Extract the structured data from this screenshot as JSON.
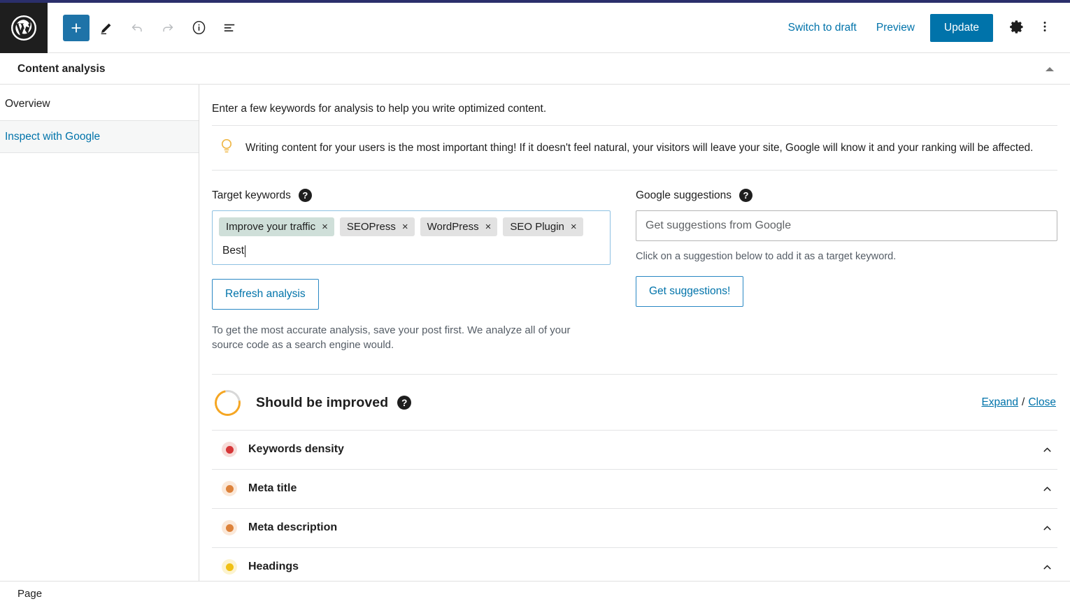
{
  "theme": {
    "accent_blue": "#0073aa",
    "strip_purple": "#2b2f6b",
    "logo_bg": "#1e1e1e",
    "tag_gray": "#e2e2e2",
    "tag_highlight_green": "#cfdfd9",
    "ring_orange": "#f5a623"
  },
  "topbar": {
    "logo_icon": "wordpress-logo-icon",
    "tools": [
      {
        "name": "add-block-button",
        "icon": "plus-icon",
        "label": "+"
      },
      {
        "name": "edit-tool-button",
        "icon": "pencil-icon",
        "label": ""
      },
      {
        "name": "undo-button",
        "icon": "undo-arrow-icon",
        "label": ""
      },
      {
        "name": "redo-button",
        "icon": "redo-arrow-icon",
        "label": ""
      },
      {
        "name": "details-button",
        "icon": "info-circle-icon",
        "label": ""
      },
      {
        "name": "list-view-button",
        "icon": "list-view-icon",
        "label": ""
      }
    ],
    "switch_to_draft": "Switch to draft",
    "preview": "Preview",
    "update": "Update",
    "settings_icon": "gear-icon",
    "more_icon": "three-dots-vertical-icon"
  },
  "panel": {
    "title": "Content analysis",
    "collapse_icon": "triangle-up-icon"
  },
  "sidebar": {
    "items": [
      {
        "label": "Overview",
        "active": true
      },
      {
        "label": "Inspect with Google",
        "active": false
      }
    ]
  },
  "main": {
    "intro": "Enter a few keywords for analysis to help you write optimized content.",
    "notice": {
      "icon": "lightbulb-icon",
      "text": "Writing content for your users is the most important thing! If it doesn't feel natural, your visitors will leave your site, Google will know it and your ranking will be affected."
    },
    "target_keywords": {
      "label": "Target keywords",
      "help_icon": "question-mark-icon",
      "tags": [
        {
          "text": "Improve your traffic",
          "remove": "×",
          "highlight": true
        },
        {
          "text": "SEOPress",
          "remove": "×",
          "highlight": false
        },
        {
          "text": "WordPress",
          "remove": "×",
          "highlight": false
        },
        {
          "text": "SEO Plugin",
          "remove": "×",
          "highlight": false
        }
      ],
      "input_value": "Best",
      "refresh_button": "Refresh analysis",
      "note": "To get the most accurate analysis, save your post first. We analyze all of your source code as a search engine would."
    },
    "google_suggestions": {
      "label": "Google suggestions",
      "help_icon": "question-mark-icon",
      "input_value": "",
      "input_placeholder": "Get suggestions from Google",
      "hint": "Click on a suggestion below to add it as a target keyword.",
      "button": "Get suggestions!"
    },
    "score": {
      "status": "Should be improved",
      "help_icon": "question-mark-icon",
      "ring_icon": "progress-ring-icon",
      "expand": "Expand",
      "separator": "/",
      "close": "Close"
    },
    "checks": [
      {
        "label": "Keywords density",
        "dot_color": "#d63638",
        "halo": "#f7dcd9",
        "chevron": "chevron-up-icon"
      },
      {
        "label": "Meta title",
        "dot_color": "#dd823b",
        "halo": "#fbe8d8",
        "chevron": "chevron-up-icon"
      },
      {
        "label": "Meta description",
        "dot_color": "#dd823b",
        "halo": "#fbe8d8",
        "chevron": "chevron-up-icon"
      },
      {
        "label": "Headings",
        "dot_color": "#f0c014",
        "halo": "#fcf3cf",
        "chevron": "chevron-up-icon"
      }
    ]
  },
  "bottombar": {
    "label": "Page"
  }
}
